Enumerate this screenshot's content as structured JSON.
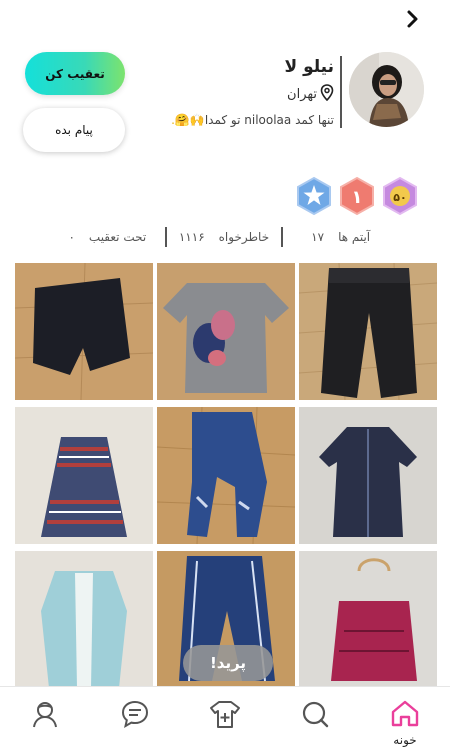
{
  "profile": {
    "name": "نیلو لا",
    "location": "تهران",
    "bio_text": "تنها کمد niloolaa تو کمدا",
    "bio_emoji": "🙌🤗."
  },
  "actions": {
    "follow_label": "تعقیب کن",
    "message_label": "پیام بده"
  },
  "badges": [
    {
      "name": "star-badge",
      "color": "#6fa8e6"
    },
    {
      "name": "level-badge",
      "text": "۱",
      "color": "#ef7b70"
    },
    {
      "name": "count-badge",
      "text": "۵۰",
      "color": "#c58adf"
    }
  ],
  "stats": {
    "items_label": "آیتم ها",
    "items_value": "۱۷",
    "likes_label": "خاطرخواه",
    "likes_value": "۱۱۱۶",
    "following_label": "تحت تعقیب",
    "following_value": "۰"
  },
  "toast": "پرید!",
  "tabbar": {
    "home_label": "خونه",
    "active_color": "#ea3f9b"
  }
}
